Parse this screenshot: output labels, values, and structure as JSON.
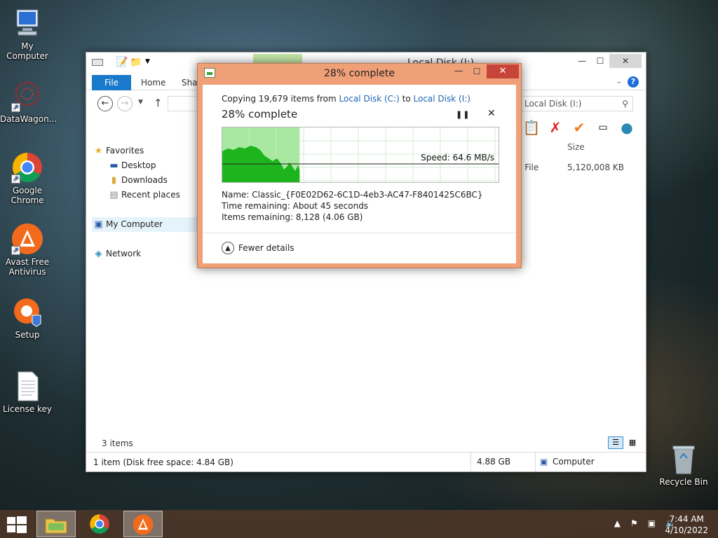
{
  "desktop": {
    "icons": [
      {
        "label": "My Computer"
      },
      {
        "label": "DataWagon..."
      },
      {
        "label": "Google Chrome"
      },
      {
        "label": "Avast Free Antivirus"
      },
      {
        "label": "Setup"
      },
      {
        "label": "License key"
      },
      {
        "label": "Recycle Bin"
      }
    ]
  },
  "explorer": {
    "title": "Local Disk (I:)",
    "ribbon": {
      "file": "File",
      "home": "Home",
      "share": "Shar"
    },
    "search_placeholder": "Local Disk (I:)",
    "nav": {
      "favorites": "Favorites",
      "desktop": "Desktop",
      "downloads": "Downloads",
      "recent": "Recent places",
      "computer": "My Computer",
      "network": "Network"
    },
    "column_size": "Size",
    "file_type": "e File",
    "file_size": "5,120,008 KB",
    "items_count": "3 items",
    "status_left": "1 item (Disk free space: 4.84 GB)",
    "status_mid": "4.88 GB",
    "status_right": "Computer"
  },
  "copy_dialog": {
    "title": "28% complete",
    "copy_prefix": "Copying 19,679 items from ",
    "source": "Local Disk (C:)",
    "to_word": " to ",
    "dest": "Local Disk (I:)",
    "percent_text": "28% complete",
    "progress_fraction": 0.28,
    "speed": "Speed: 64.6 MB/s",
    "name_line": "Name:  Classic_{F0E02D62-6C1D-4eb3-AC47-F8401425C6BC}",
    "time_line": "Time remaining:  About 45 seconds",
    "items_line": "Items remaining:  8,128 (4.06 GB)",
    "fewer_details": "Fewer details",
    "colors": {
      "frame": "#f0a077",
      "graph_fill": "#1db41d",
      "graph_bg": "#a9e8a0"
    }
  },
  "taskbar": {
    "time": "7:44 AM",
    "date": "4/10/2022"
  }
}
